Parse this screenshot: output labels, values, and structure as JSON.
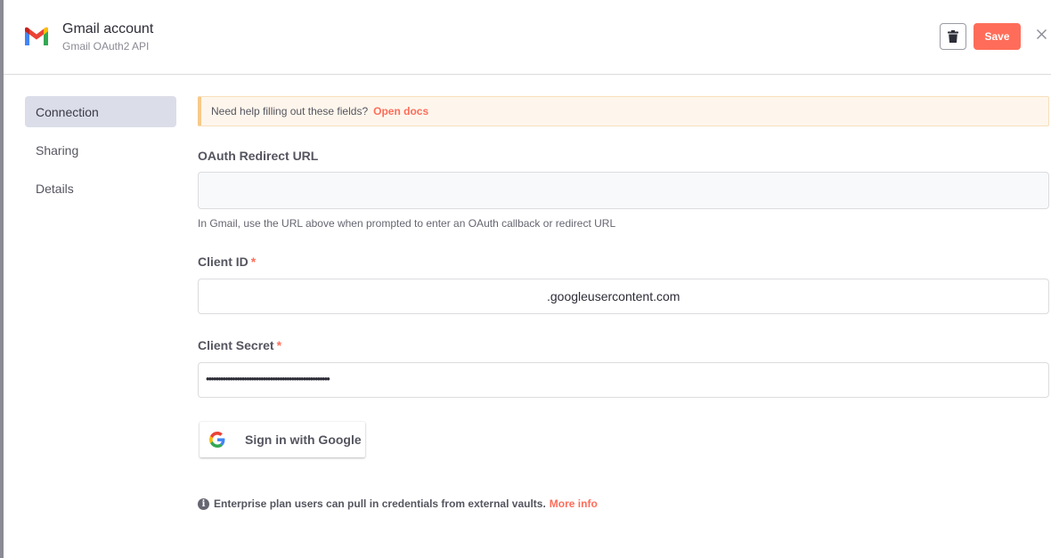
{
  "header": {
    "title": "Gmail account",
    "subtitle": "Gmail OAuth2 API",
    "save_label": "Save"
  },
  "sidebar": {
    "items": [
      {
        "label": "Connection",
        "active": true
      },
      {
        "label": "Sharing",
        "active": false
      },
      {
        "label": "Details",
        "active": false
      }
    ]
  },
  "help": {
    "text": "Need help filling out these fields?",
    "link": "Open docs"
  },
  "oauth_redirect": {
    "label": "OAuth Redirect URL",
    "value": "",
    "hint": "In Gmail, use the URL above when prompted to enter an OAuth callback or redirect URL"
  },
  "client_id": {
    "label": "Client ID",
    "required": "*",
    "value": ".googleusercontent.com"
  },
  "client_secret": {
    "label": "Client Secret",
    "required": "*",
    "value": "••••••••••••••••••••••••••••••••••••••••••••••••••••"
  },
  "google_signin": {
    "label": "Sign in with Google"
  },
  "enterprise": {
    "text": "Enterprise plan users can pull in credentials from external vaults.",
    "link": "More info"
  },
  "colors": {
    "accent": "#ff6d5a",
    "active_nav_bg": "#dbdde8",
    "banner_bg": "#fef6ec"
  },
  "icons": {
    "logo": "gmail-logo-icon",
    "delete": "trash-icon",
    "close": "close-icon",
    "google": "google-g-icon",
    "info": "info-icon"
  }
}
